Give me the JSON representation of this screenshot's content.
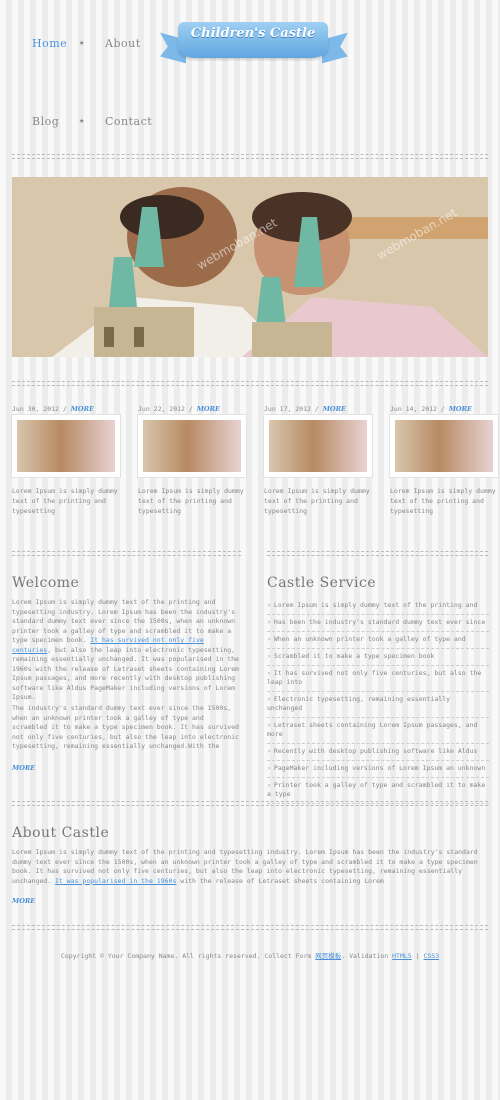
{
  "nav": {
    "home": "Home",
    "about": "About",
    "blog": "Blog",
    "contact": "Contact",
    "separator": "★"
  },
  "logo": {
    "text": "Children's Castle"
  },
  "hero": {
    "watermark": "webmoban.net"
  },
  "posts": [
    {
      "date": "Jun 30, 2012",
      "sep": "/",
      "more": "MORE",
      "text": "Lorem Ipsum is simply dummy text of the printing and typesetting"
    },
    {
      "date": "Jun 22, 2012",
      "sep": "/",
      "more": "MORE",
      "text": "Lorem Ipsum is simply dummy text of the printing and typesetting"
    },
    {
      "date": "Jun 17, 2012",
      "sep": "/",
      "more": "MORE",
      "text": "Lorem Ipsum is simply dummy text of the printing and typesetting"
    },
    {
      "date": "Jun 14, 2012",
      "sep": "/",
      "more": "MORE",
      "text": "Lorem Ipsum is simply dummy text of the printing and typesetting"
    }
  ],
  "welcome": {
    "title": "Welcome",
    "p1_a": "Lorem Ipsum is simply dummy text of the printing and typesetting industry. Lorem Ipsum has been the industry's standard dummy text ever since the 1500s, when an unknown printer took a galley of type and scrambled it to make a type specimen book. ",
    "p1_link": "It has survived not only five centuries",
    "p1_b": ", but also the leap into electronic typesetting, remaining essentially unchanged. It was popularised in the 1960s with the release of Letraset sheets containing Lorem Ipsum passages, and more recently with desktop publishing software like Aldus PageMaker including versions of Lorem Ipsum.",
    "p2": "The industry's standard dummy text ever since the 1500s, when an unknown printer took a galley of type and scrambled it to make a type specimen book. It has survived not only five centuries, but also the leap into electronic typesetting, remaining essentially unchanged.With the",
    "more": "MORE"
  },
  "service": {
    "title": "Castle Service",
    "arrow": "›",
    "items": [
      "Lorem Ipsum is simply dummy text of the printing and",
      "Has been the industry's standard dummy text ever since",
      "When an unknown printer took a galley of type and",
      "Scrambled it to make a type specimen book",
      "It has survived not only five centuries, but also the leap into",
      "Electronic typesetting, remaining essentially unchanged",
      "Letraset sheets containing Lorem Ipsum passages, and more",
      "Recently with desktop publishing software like Aldus",
      "PageMaker including versions of Lorem Ipsum an unknown",
      "Printer took a galley of type and scrambled it to make a type"
    ]
  },
  "about": {
    "title": "About Castle",
    "p_a": "Lorem Ipsum is simply dummy text of the printing and typesetting industry. Lorem Ipsum has been the industry's standard dummy text ever since the 1500s, when an unknown printer took a galley of type and scrambled it to make a type specimen book. It has survived not only five centuries, but also the leap into electronic typesetting, remaining essentially unchanged. ",
    "p_link": "It was popularised in the 1960s",
    "p_b": " with the release of Letraset sheets containing Lorem",
    "more": "MORE"
  },
  "footer": {
    "copyright": "Copyright © Your Company Name. All rights reserved. Collect Form ",
    "collect_link": "网页模板",
    "validation": ". Validation ",
    "html5": "HTML5",
    "pipe": " | ",
    "css3": "CSS3"
  },
  "colors": {
    "accent": "#4a90d9",
    "text": "#888888",
    "background": "#f1f1f1",
    "logo_ribbon": "#5fa6e0"
  }
}
